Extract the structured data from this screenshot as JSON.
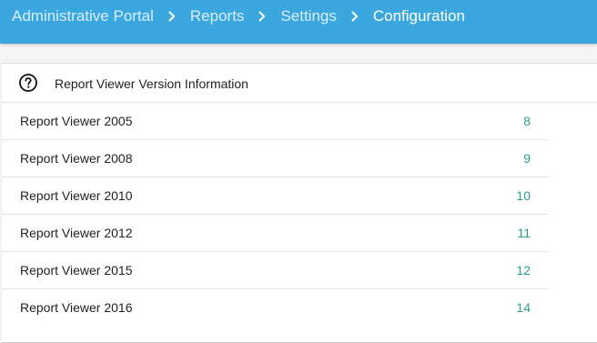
{
  "breadcrumb": {
    "items": [
      "Administrative Portal",
      "Reports",
      "Settings",
      "Configuration"
    ]
  },
  "section": {
    "icon": "help-circle-icon",
    "title": "Report Viewer Version Information"
  },
  "versions": [
    {
      "label": "Report Viewer 2005",
      "value": "8"
    },
    {
      "label": "Report Viewer 2008",
      "value": "9"
    },
    {
      "label": "Report Viewer 2010",
      "value": "10"
    },
    {
      "label": "Report Viewer 2012",
      "value": "11"
    },
    {
      "label": "Report Viewer 2015",
      "value": "12"
    },
    {
      "label": "Report Viewer 2016",
      "value": "14"
    }
  ],
  "colors": {
    "header": "#3aa8de",
    "crumb_link": "#d8eefa",
    "crumb_current": "#ffffff",
    "value_link": "#2a9d8f"
  }
}
